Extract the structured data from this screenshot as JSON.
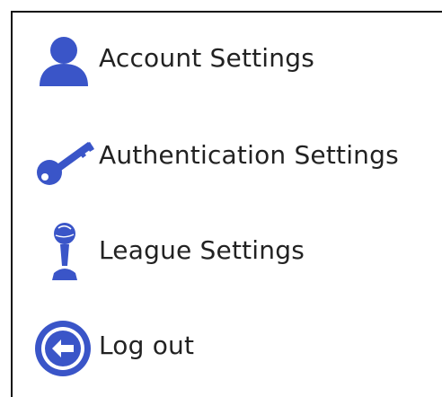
{
  "menu": {
    "items": [
      {
        "label": "Account Settings",
        "icon": "user-icon"
      },
      {
        "label": "Authentication Settings",
        "icon": "key-icon"
      },
      {
        "label": "League Settings",
        "icon": "trophy-icon"
      },
      {
        "label": "Log out",
        "icon": "logout-icon"
      }
    ]
  },
  "colors": {
    "icon": "#3a55c8",
    "text": "#222222",
    "border": "#111111"
  }
}
